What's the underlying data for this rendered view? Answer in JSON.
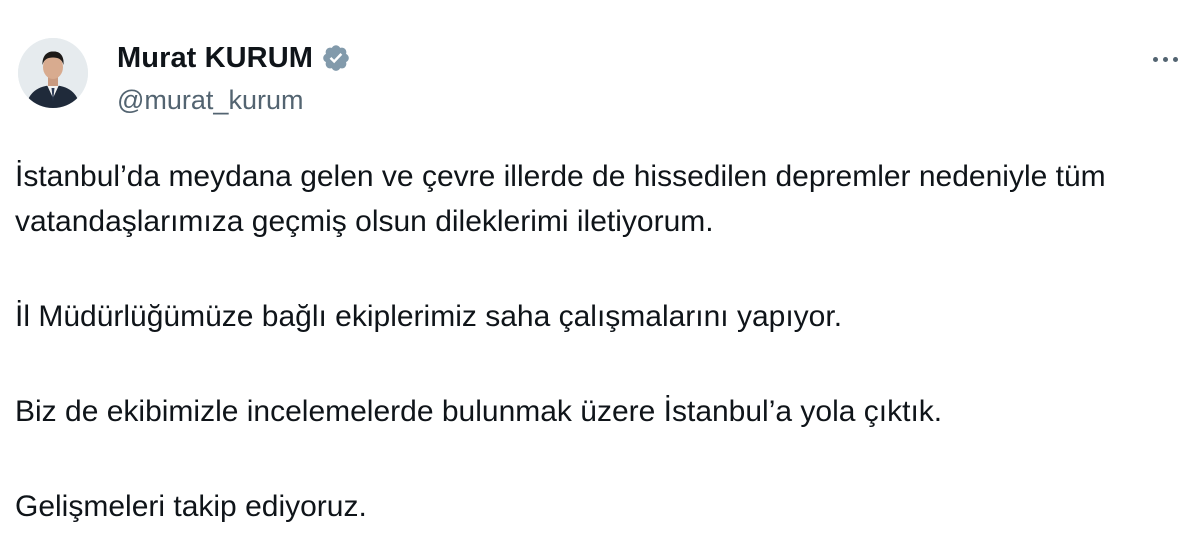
{
  "author": {
    "display_name": "Murat KURUM",
    "handle": "@murat_kurum",
    "verified": true,
    "verified_color": "#829aab"
  },
  "actions": {
    "more_icon": "more-horizontal-icon"
  },
  "tweet": {
    "paragraphs": [
      "İstanbul’da meydana gelen ve çevre illerde de hissedilen depremler nedeniyle tüm vatandaşlarımıza geçmiş olsun dileklerimi iletiyorum.",
      "İl Müdürlüğümüze bağlı ekiplerimiz saha çalışmalarını yapıyor.",
      "Biz de ekibimizle incelemelerde bulunmak üzere İstanbul’a yola çıktık.",
      "Gelişmeleri takip ediyoruz."
    ]
  },
  "colors": {
    "text_primary": "#0f1419",
    "text_secondary": "#536471"
  }
}
